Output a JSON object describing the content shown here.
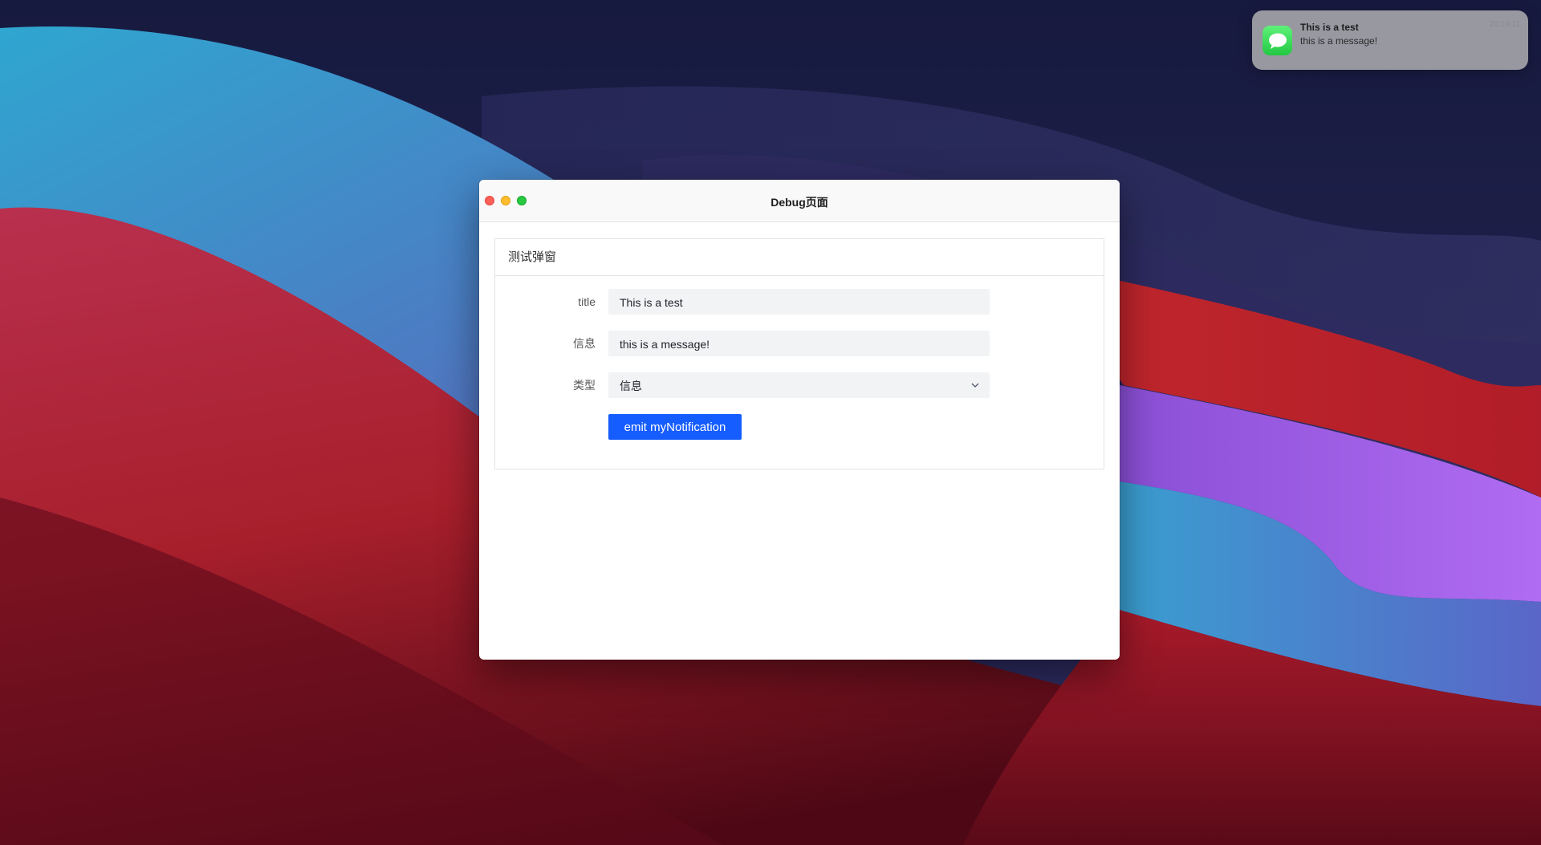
{
  "notification": {
    "title": "This is a test",
    "body": "this is a message!",
    "time": "20:19:11",
    "app_icon": "messages-icon",
    "accent": "#2fd155"
  },
  "window": {
    "title": "Debug页面",
    "controls": [
      "close",
      "minimize",
      "maximize"
    ],
    "traffic_colors": {
      "close": "#fe5f57",
      "minimize": "#febc2e",
      "maximize": "#28c840"
    }
  },
  "card": {
    "header": "测试弹窗"
  },
  "form": {
    "title_label": "title",
    "title_value": "This is a test",
    "message_label": "信息",
    "message_value": "this is a message!",
    "type_label": "类型",
    "type_value": "信息",
    "type_icon": "chevron-down-icon",
    "submit_label": "emit myNotification",
    "accent": "#165dff"
  }
}
